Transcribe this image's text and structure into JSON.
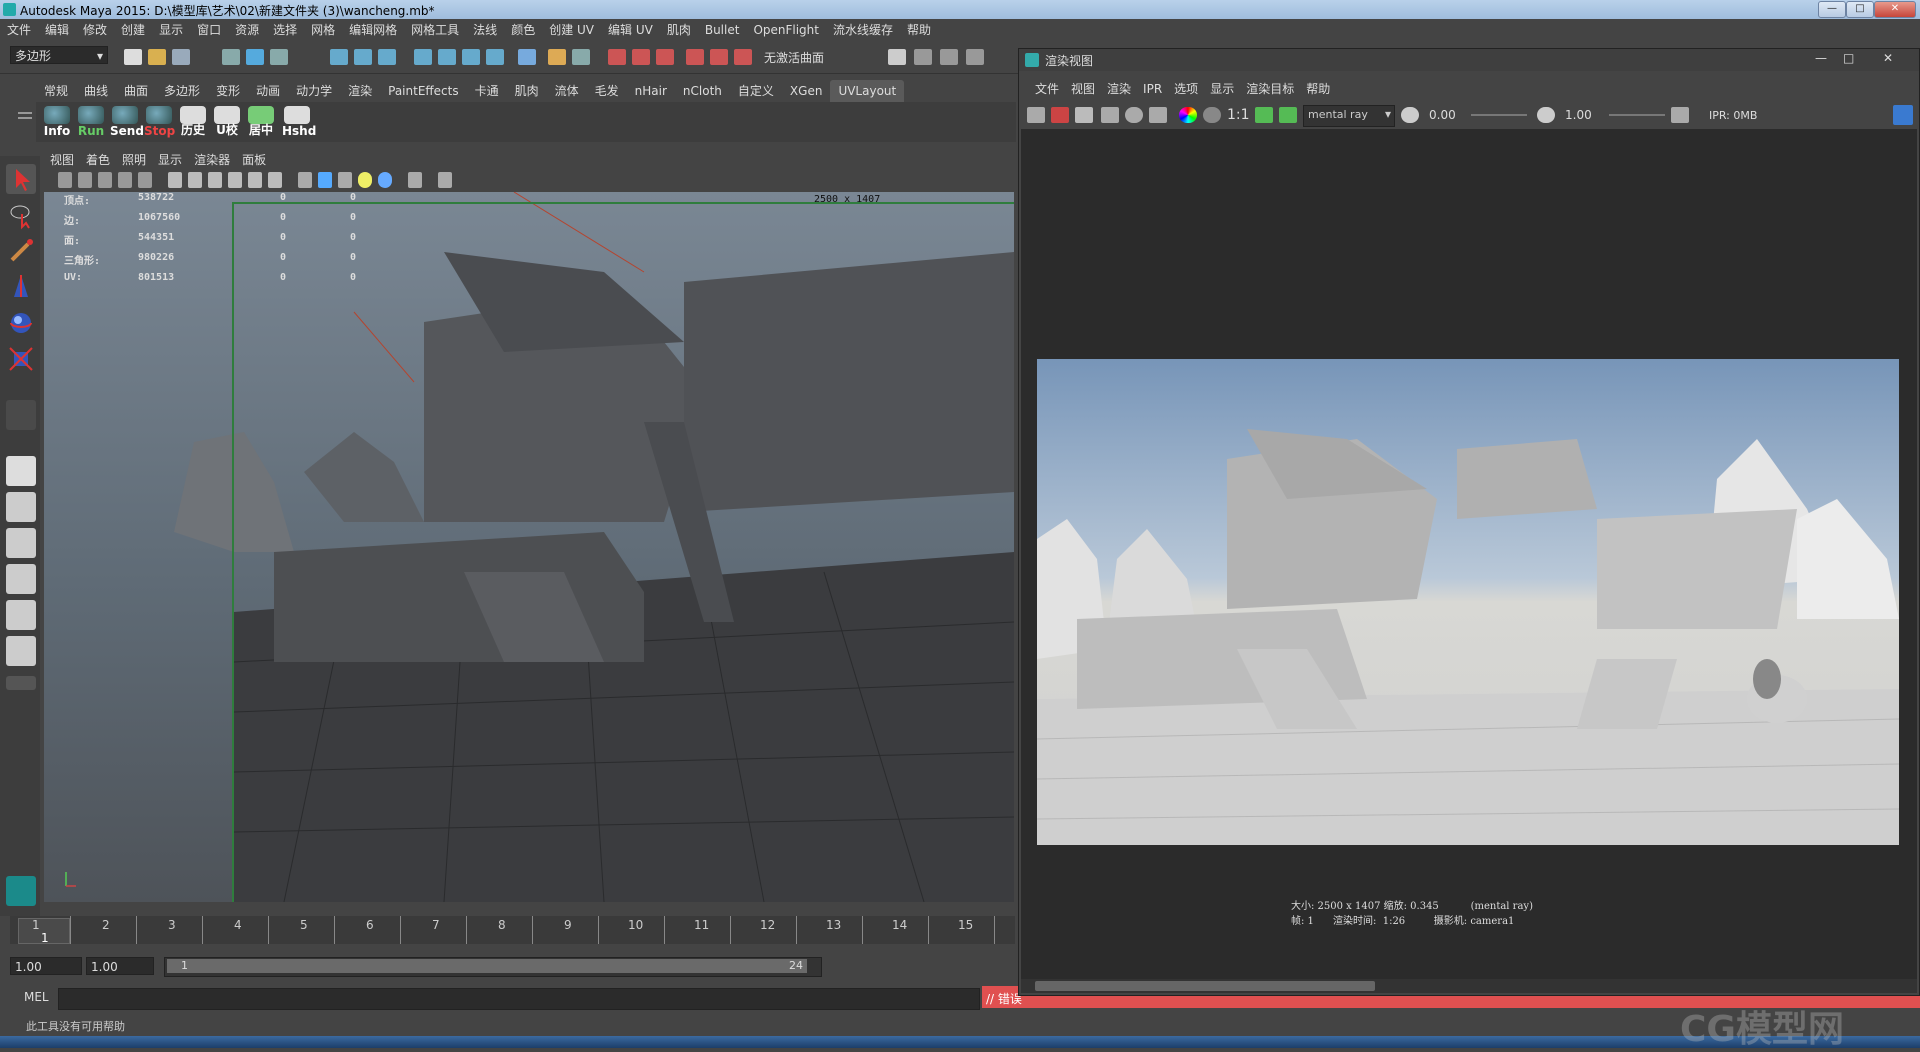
{
  "titlebar": {
    "title": "Autodesk Maya 2015: D:\\模型库\\艺术\\02\\新建文件夹 (3)\\wancheng.mb*"
  },
  "menubar": {
    "items": [
      "文件",
      "编辑",
      "修改",
      "创建",
      "显示",
      "窗口",
      "资源",
      "选择",
      "网格",
      "编辑网格",
      "网格工具",
      "法线",
      "颜色",
      "创建 UV",
      "编辑 UV",
      "肌肉",
      "Bullet",
      "OpenFlight",
      "流水线缓存",
      "帮助"
    ]
  },
  "statusline": {
    "mode": "多边形",
    "live_label": "无激活曲面"
  },
  "shelf": {
    "tabs": [
      "常规",
      "曲线",
      "曲面",
      "多边形",
      "变形",
      "动画",
      "动力学",
      "渲染",
      "PaintEffects",
      "卡通",
      "肌肉",
      "流体",
      "毛发",
      "nHair",
      "nCloth",
      "自定义",
      "XGen",
      "UVLayout"
    ],
    "active_tab": "UVLayout",
    "buttons": [
      "Info",
      "Run",
      "Send",
      "Stop",
      "历史",
      "U校",
      "居中",
      "Hshd"
    ]
  },
  "viewport": {
    "menu": [
      "视图",
      "着色",
      "照明",
      "显示",
      "渲染器",
      "面板"
    ],
    "hud": [
      {
        "label": "顶点:",
        "v1": "538722",
        "v2": "0",
        "v3": "0"
      },
      {
        "label": "边:",
        "v1": "1067560",
        "v2": "0",
        "v3": "0"
      },
      {
        "label": "面:",
        "v1": "544351",
        "v2": "0",
        "v3": "0"
      },
      {
        "label": "三角形:",
        "v1": "980226",
        "v2": "0",
        "v3": "0"
      },
      {
        "label": "UV:",
        "v1": "801513",
        "v2": "0",
        "v3": "0"
      }
    ],
    "resolution_gate": "2500 x 1407"
  },
  "timeslider": {
    "ticks": [
      "1",
      "2",
      "3",
      "4",
      "5",
      "6",
      "7",
      "8",
      "9",
      "10",
      "11",
      "12",
      "13",
      "14",
      "15"
    ],
    "current_frame": "1"
  },
  "range": {
    "start": "1.00",
    "start2": "1.00",
    "range_start": "1",
    "range_end": "24"
  },
  "commandline": {
    "label": "MEL",
    "error_text": "// 错误"
  },
  "helpline": {
    "text": "此工具没有可用帮助"
  },
  "renderview": {
    "title": "渲染视图",
    "menu": [
      "文件",
      "视图",
      "渲染",
      "IPR",
      "选项",
      "显示",
      "渲染目标",
      "帮助"
    ],
    "ratio": "1:1",
    "renderer": "mental ray",
    "exposure": "0.00",
    "gamma": "1.00",
    "ipr_mem": "IPR: 0MB",
    "info_line1": "大小: 2500 x 1407 缩放: 0.345          (mental ray)",
    "info_line2": "帧: 1      渲染时间:  1:26         摄影机: camera1"
  },
  "watermark": "CG模型网"
}
